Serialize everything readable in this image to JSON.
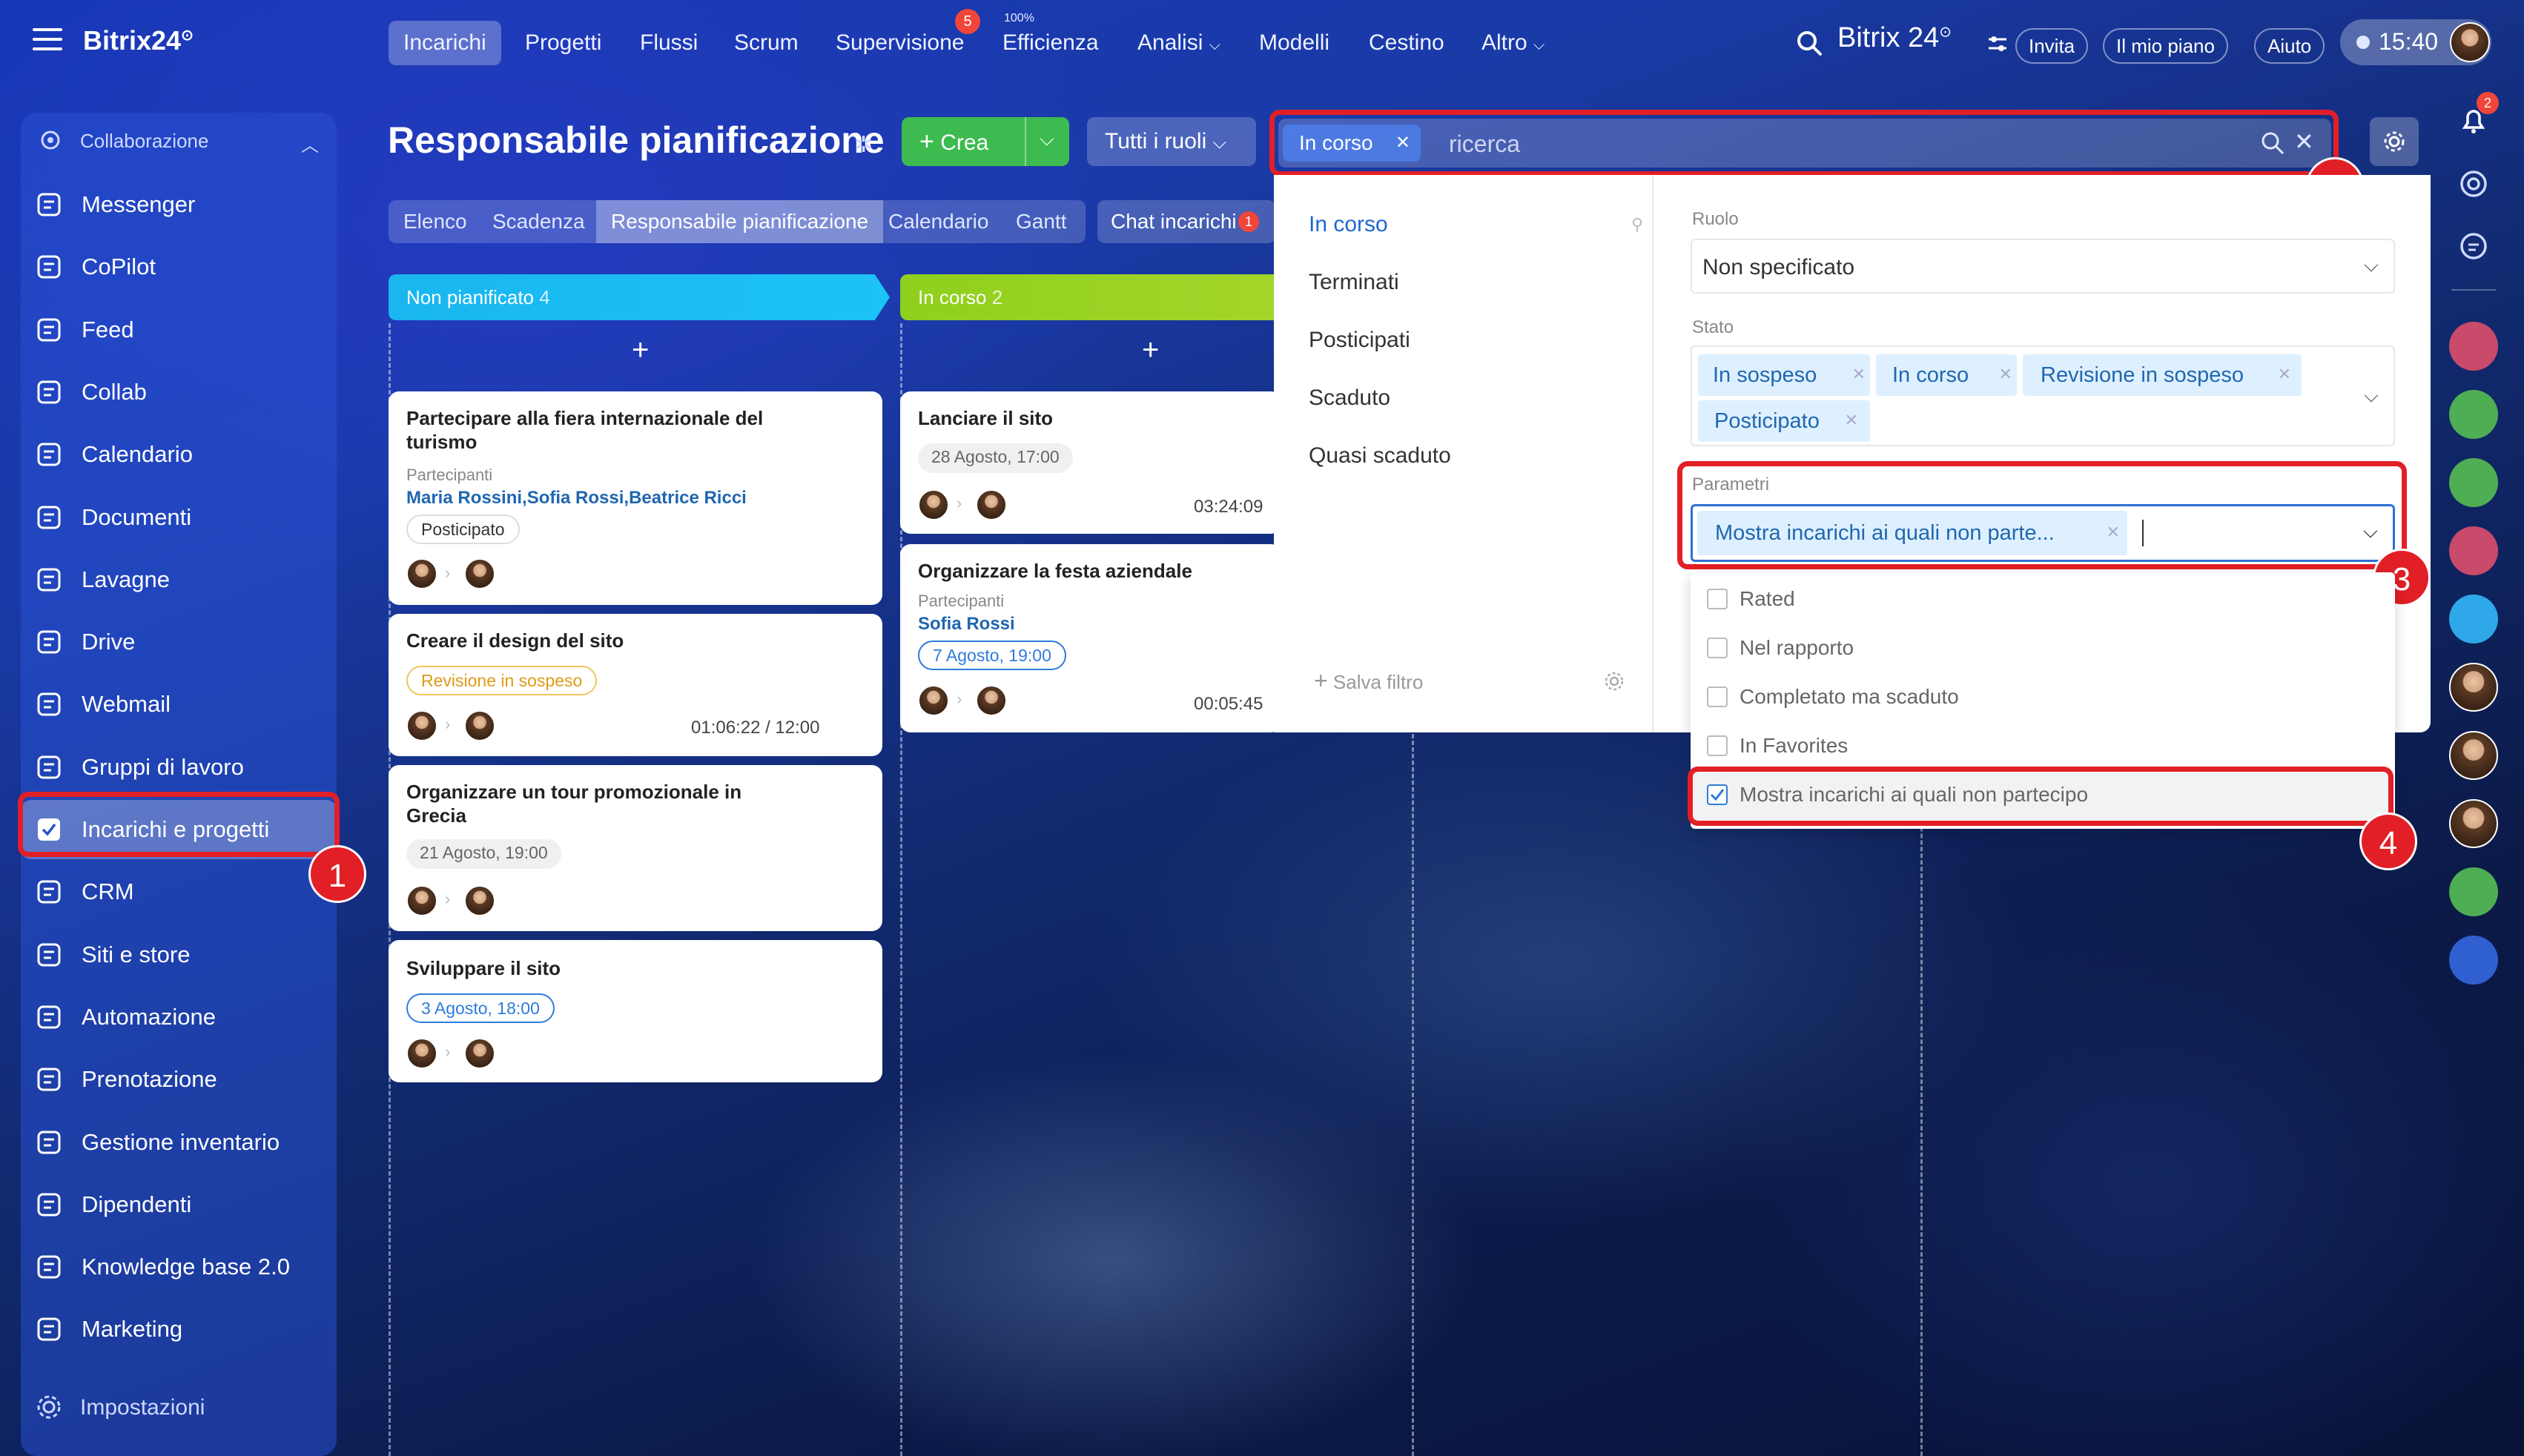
{
  "topbar": {
    "logo": "Bitrix24",
    "logo_mark": "⊙",
    "nav": [
      "Incarichi",
      "Progetti",
      "Flussi",
      "Scrum",
      "Supervisione",
      "Efficienza",
      "Analisi",
      "Modelli",
      "Cestino",
      "Altro"
    ],
    "supervisione_badge": "5",
    "efficienza_pct": "100%",
    "brand_right": "Bitrix 24",
    "invite": "Invita",
    "my_plan": "Il mio piano",
    "help": "Aiuto",
    "clock": "15:40",
    "notif_badge": "2"
  },
  "sidebar": {
    "section": "Collaborazione",
    "items": [
      "Messenger",
      "CoPilot",
      "Feed",
      "Collab",
      "Calendario",
      "Documenti",
      "Lavagne",
      "Drive",
      "Webmail",
      "Gruppi di lavoro",
      "Incarichi e progetti",
      "CRM",
      "Siti e store",
      "Automazione",
      "Prenotazione",
      "Gestione inventario",
      "Dipendenti",
      "Knowledge base 2.0",
      "Marketing"
    ],
    "settings": "Impostazioni"
  },
  "page": {
    "title": "Responsabile pianificazione",
    "create": "Crea",
    "roles": "Tutti i ruoli",
    "search_chip": "In corso",
    "search_placeholder": "ricerca",
    "tabs": [
      "Elenco",
      "Scadenza",
      "Responsabile pianificazione",
      "Calendario",
      "Gantt"
    ],
    "chat": "Chat incarichi",
    "chat_badge": "1"
  },
  "kanban": {
    "col1": {
      "name": "Non pianificato",
      "count": "4"
    },
    "col2": {
      "name": "In corso",
      "count": "2"
    },
    "cards1": [
      {
        "title": "Partecipare alla fiera internazionale del turismo",
        "participants_label": "Partecipanti",
        "participants": "Maria Rossini,Sofia Rossi,Beatrice Ricci",
        "status": "Posticipato"
      },
      {
        "title": "Creare il design del sito",
        "status": "Revisione in sospeso",
        "time": "01:06:22 / 12:00"
      },
      {
        "title": "Organizzare un tour promozionale in Grecia",
        "date": "21 Agosto, 19:00"
      },
      {
        "title": "Sviluppare il sito",
        "date": "3 Agosto, 18:00"
      }
    ],
    "cards2": [
      {
        "title": "Lanciare il sito",
        "date": "28 Agosto, 17:00",
        "time": "03:24:09"
      },
      {
        "title": "Organizzare la festa aziendale",
        "participants_label": "Partecipanti",
        "participants": "Sofia Rossi",
        "date": "7 Agosto, 19:00",
        "time": "00:05:45"
      }
    ]
  },
  "filter": {
    "presets": [
      "In corso",
      "Terminati",
      "Posticipati",
      "Scaduto",
      "Quasi scaduto"
    ],
    "save": "Salva filtro",
    "role_label": "Ruolo",
    "role_value": "Non specificato",
    "status_label": "Stato",
    "status_tags": [
      "In sospeso",
      "In corso",
      "Revisione in sospeso",
      "Posticipato"
    ],
    "params_label": "Parametri",
    "params_tag": "Mostra incarichi ai quali non parte...",
    "options": [
      "Rated",
      "Nel rapporto",
      "Completato ma scaduto",
      "In Favorites",
      "Mostra incarichi ai quali non partecipo"
    ],
    "checked_index": 4
  },
  "callouts": [
    "1",
    "2",
    "3",
    "4"
  ]
}
